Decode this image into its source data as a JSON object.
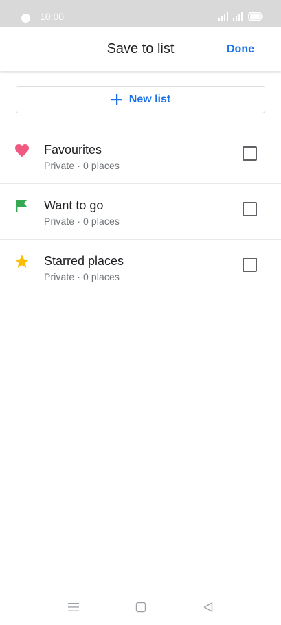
{
  "status_bar": {
    "time": "10:00"
  },
  "header": {
    "title": "Save to list",
    "done_label": "Done"
  },
  "new_list": {
    "label": "New list"
  },
  "lists": [
    {
      "name": "Favourites",
      "meta": "Private · 0 places",
      "icon": "heart-icon",
      "color": "#f05a80",
      "checked": false
    },
    {
      "name": "Want to go",
      "meta": "Private · 0 places",
      "icon": "flag-icon",
      "color": "#34a853",
      "checked": false
    },
    {
      "name": "Starred places",
      "meta": "Private · 0 places",
      "icon": "star-icon",
      "color": "#fbbc04",
      "checked": false
    }
  ],
  "colors": {
    "accent": "#1a73e8",
    "status_bar": "#d9d9d9"
  }
}
